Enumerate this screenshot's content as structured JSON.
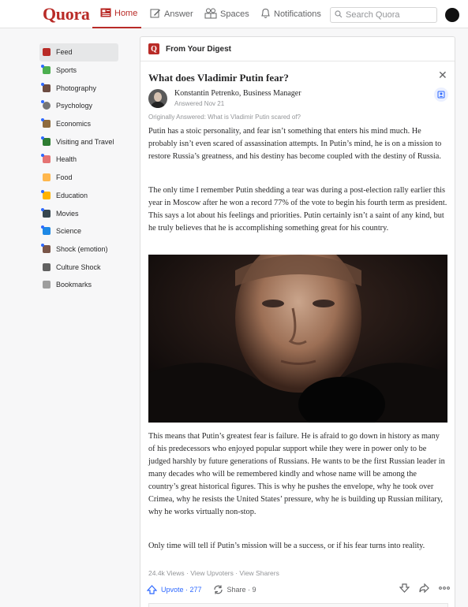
{
  "app": {
    "logo": "Quora",
    "brand_color": "#b92b27"
  },
  "nav": {
    "home": "Home",
    "answer": "Answer",
    "spaces": "Spaces",
    "notifications": "Notifications",
    "search_placeholder": "Search Quora"
  },
  "sidebar": {
    "items": [
      {
        "label": "Feed",
        "color": "#b92b27"
      },
      {
        "label": "Sports",
        "color": "#4caf50"
      },
      {
        "label": "Photography",
        "color": "#6d4c41"
      },
      {
        "label": "Psychology",
        "color": "#757575"
      },
      {
        "label": "Economics",
        "color": "#8e6b3d"
      },
      {
        "label": "Visiting and Travel",
        "color": "#2e7d32"
      },
      {
        "label": "Health",
        "color": "#e57373"
      },
      {
        "label": "Food",
        "color": "#ffb74d"
      },
      {
        "label": "Education",
        "color": "#ffb300"
      },
      {
        "label": "Movies",
        "color": "#37474f"
      },
      {
        "label": "Science",
        "color": "#1e88e5"
      },
      {
        "label": "Shock (emotion)",
        "color": "#795548"
      },
      {
        "label": "Culture Shock",
        "color": "#616161"
      },
      {
        "label": "Bookmarks",
        "color": "#9e9e9e"
      }
    ]
  },
  "card": {
    "header": "From Your Digest",
    "question": "What does Vladimir Putin fear?",
    "author": "Konstantin Petrenko, Business Manager",
    "answered": "Answered Nov 21",
    "originally": "Originally Answered: What is Vladimir Putin scared of?",
    "paragraphs": [
      "Putin has a stoic personality, and fear isn’t something that enters his mind much. He probably isn’t even scared of assassination attempts. In Putin’s mind, he is on a mission to restore Russia’s greatness, and his destiny has become coupled with the destiny of Russia.",
      "The only time I remember Putin shedding a tear was during a post-election rally earlier this year in Moscow after he won a record 77% of the vote to begin his fourth term as president. This says a lot about his feelings and priorities. Putin certainly isn’t a saint of any kind, but he truly believes that he is accomplishing something great for his country.",
      "This means that Putin’s greatest fear is failure. He is afraid to go down in history as many of his predecessors who enjoyed popular support while they were in power only to be judged harshly by future generations of Russians. He wants to be the first Russian leader in many decades who will be remembered kindly and whose name will be among the country’s great historical figures. This is why he pushes the envelope, why he took over Crimea, why he resists the United States’ pressure, why he is building up Russian military, why he works virtually non-stop.",
      "Only time will tell if Putin’s mission will be a success, or if his fear turns into reality."
    ],
    "stats": "24.4k Views · View Upvoters · View Sharers",
    "upvote_label": "Upvote · 277",
    "share_label": "Share · 9"
  }
}
